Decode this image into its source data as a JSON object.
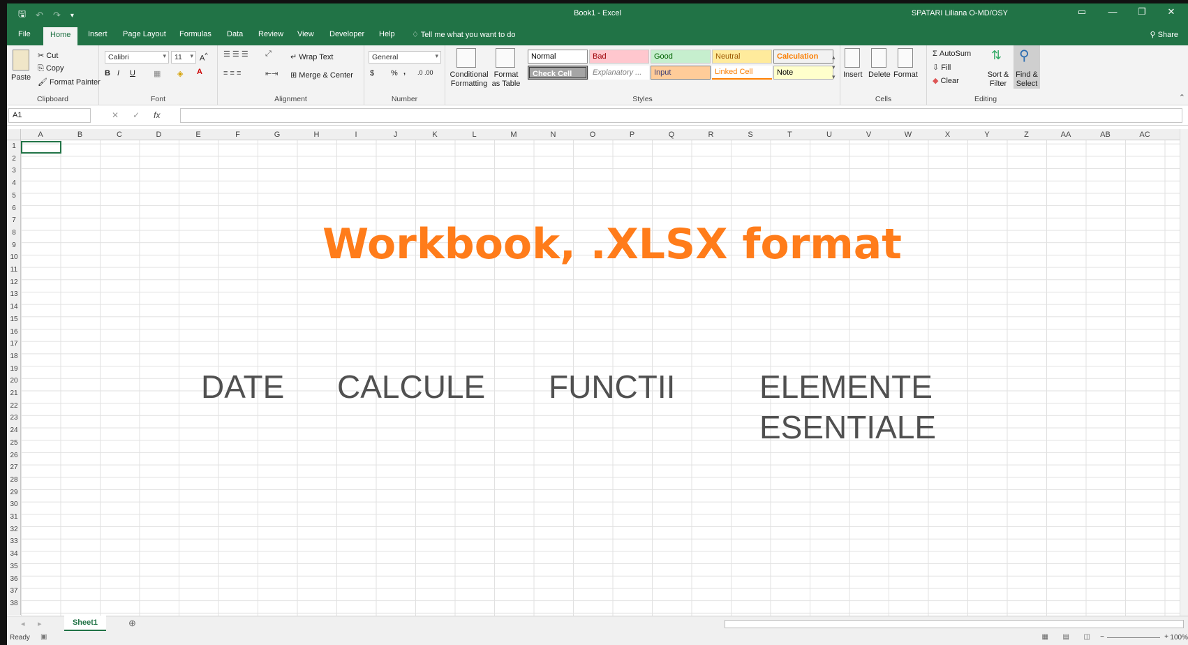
{
  "window": {
    "title": "Book1 - Excel",
    "user": "SPATARI Liliana O-MD/OSY"
  },
  "tabs": [
    "File",
    "Home",
    "Insert",
    "Page Layout",
    "Formulas",
    "Data",
    "Review",
    "View",
    "Developer",
    "Help"
  ],
  "tell_me": "Tell me what you want to do",
  "share": "Share",
  "ribbon": {
    "clipboard": {
      "paste": "Paste",
      "cut": "Cut",
      "copy": "Copy",
      "format_painter": "Format Painter",
      "label": "Clipboard"
    },
    "font": {
      "name": "Calibri",
      "size": "11",
      "bold": "B",
      "italic": "I",
      "underline": "U",
      "label": "Font"
    },
    "alignment": {
      "wrap": "Wrap Text",
      "merge": "Merge & Center",
      "label": "Alignment"
    },
    "number": {
      "format": "General",
      "currency": "$",
      "percent": "%",
      "comma": ",",
      "label": "Number"
    },
    "styles": {
      "conditional": "Conditional Formatting",
      "format_table": "Format as Table",
      "cells": [
        "Normal",
        "Bad",
        "Good",
        "Neutral",
        "Calculation",
        "Check Cell",
        "Explanatory ...",
        "Input",
        "Linked Cell",
        "Note"
      ],
      "label": "Styles"
    },
    "cells": {
      "insert": "Insert",
      "delete": "Delete",
      "format": "Format",
      "label": "Cells"
    },
    "editing": {
      "autosum": "AutoSum",
      "fill": "Fill",
      "clear": "Clear",
      "sort": "Sort & Filter",
      "find": "Find & Select",
      "label": "Editing"
    }
  },
  "formula_bar": {
    "name_box": "A1",
    "fx": "fx",
    "value": ""
  },
  "columns": [
    "A",
    "B",
    "C",
    "D",
    "E",
    "F",
    "G",
    "H",
    "I",
    "J",
    "K",
    "L",
    "M",
    "N",
    "O",
    "P",
    "Q",
    "R",
    "S",
    "T",
    "U",
    "V",
    "W",
    "X",
    "Y",
    "Z",
    "AA",
    "AB",
    "AC"
  ],
  "rows": [
    "1",
    "2",
    "3",
    "4",
    "5",
    "6",
    "7",
    "8",
    "9",
    "10",
    "11",
    "12",
    "13",
    "14",
    "15",
    "16",
    "17",
    "18",
    "19",
    "20",
    "21",
    "22",
    "23",
    "24",
    "25",
    "26",
    "27",
    "28",
    "29",
    "30",
    "31",
    "32",
    "33",
    "34",
    "35",
    "36",
    "37",
    "38"
  ],
  "overlay": {
    "title": "Workbook, .XLSX format",
    "words": [
      "DATE",
      "CALCULE",
      "FUNCTII",
      "ELEMENTE",
      "ESENTIALE"
    ]
  },
  "sheet_tab": "Sheet1",
  "status": {
    "ready": "Ready",
    "zoom": "100%"
  },
  "colors": {
    "excel_green": "#217346",
    "title_orange": "#ff7c1a"
  }
}
